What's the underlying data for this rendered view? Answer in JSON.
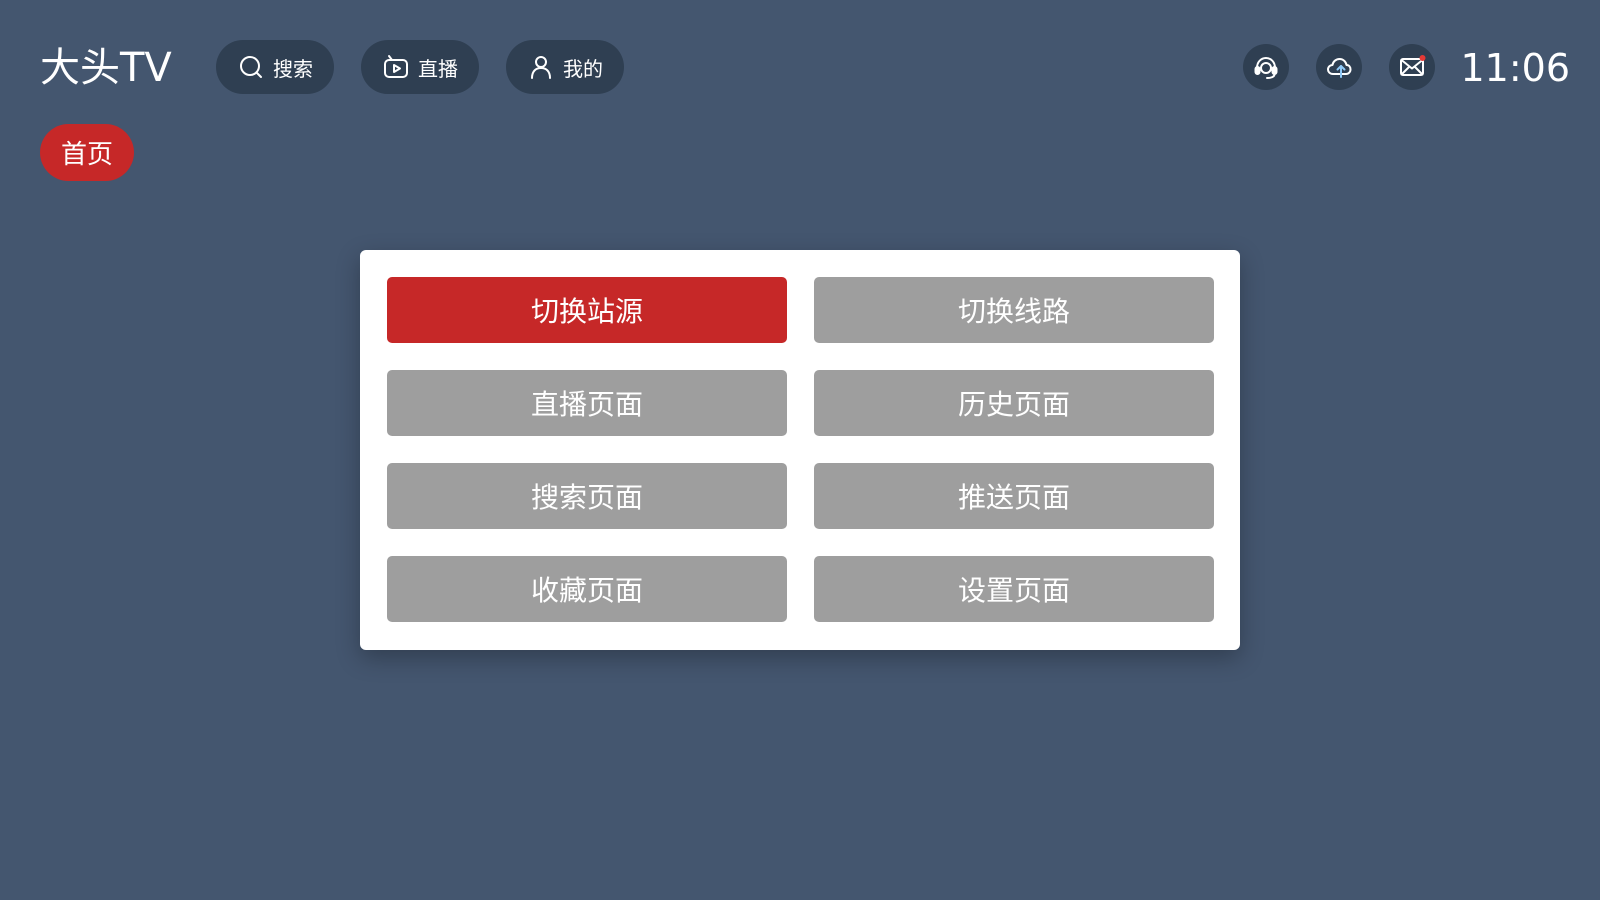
{
  "app": {
    "title": "大头TV",
    "clock": "11:06"
  },
  "colors": {
    "background": "#44566f",
    "pill": "#2f3f52",
    "accent": "#c62828",
    "menu_button": "#9e9e9e",
    "panel": "#ffffff",
    "notification_dot": "#e53935"
  },
  "nav": {
    "search": {
      "label": "搜索",
      "icon": "search-icon"
    },
    "live": {
      "label": "直播",
      "icon": "tv-icon"
    },
    "mine": {
      "label": "我的",
      "icon": "user-icon"
    }
  },
  "status_icons": [
    "support-headset-icon",
    "cloud-sync-icon",
    "mail-icon"
  ],
  "tabs": {
    "home": "首页"
  },
  "menu": {
    "items": [
      {
        "label": "切换站源",
        "active": true
      },
      {
        "label": "切换线路",
        "active": false
      },
      {
        "label": "直播页面",
        "active": false
      },
      {
        "label": "历史页面",
        "active": false
      },
      {
        "label": "搜索页面",
        "active": false
      },
      {
        "label": "推送页面",
        "active": false
      },
      {
        "label": "收藏页面",
        "active": false
      },
      {
        "label": "设置页面",
        "active": false
      }
    ]
  }
}
